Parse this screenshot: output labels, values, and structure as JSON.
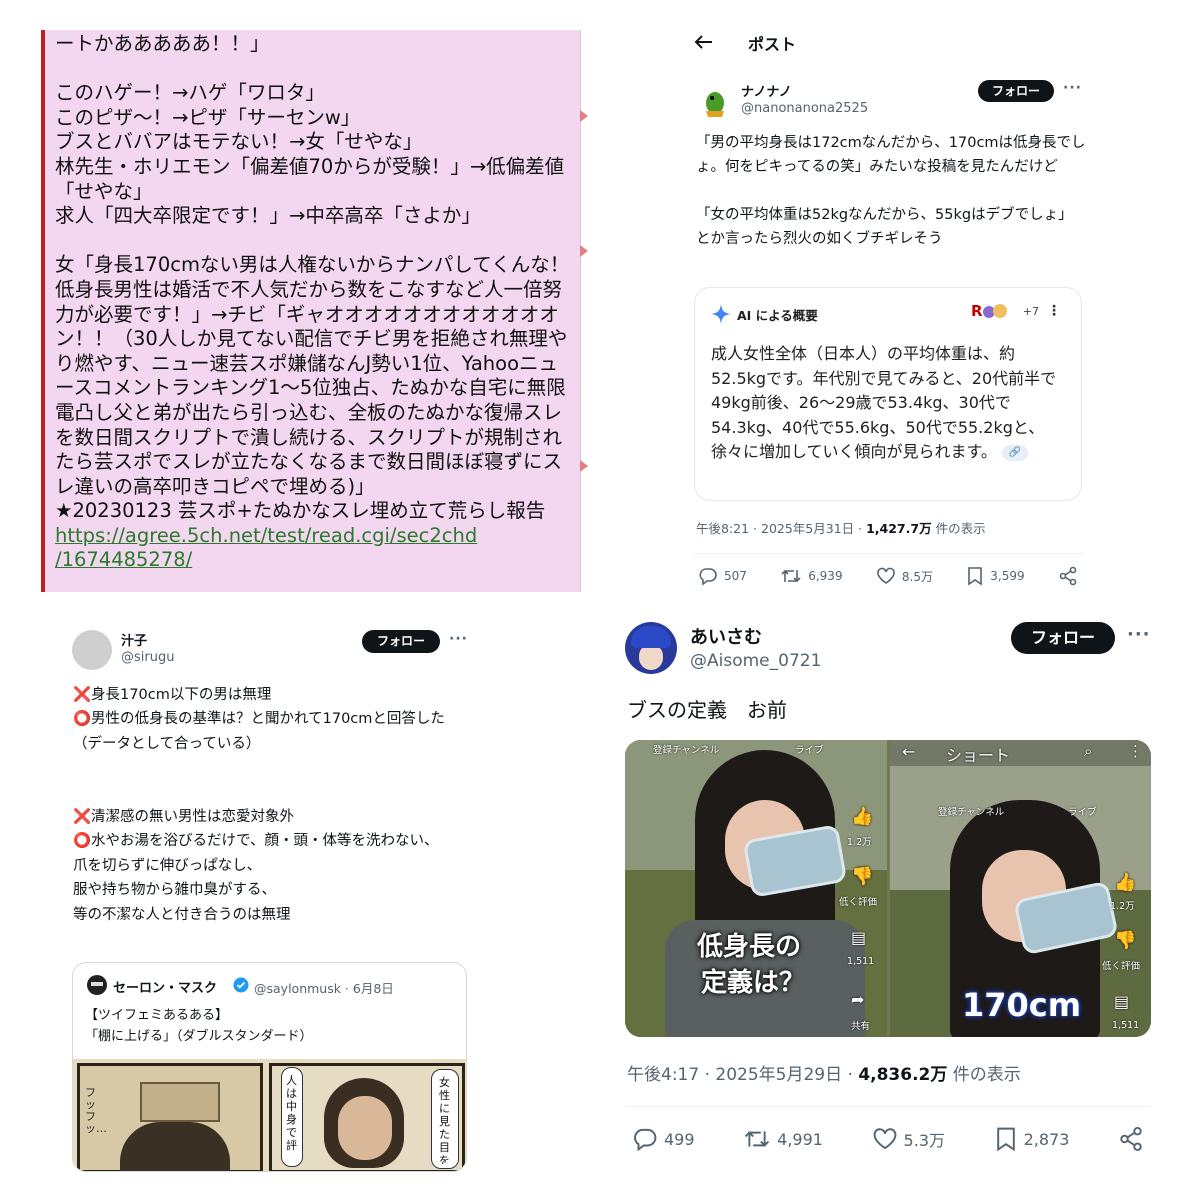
{
  "panel_a": {
    "top_line": "ートかあああああ！！」",
    "lines": [
      "",
      "このハゲー！→ハゲ「ワロタ」",
      "このピザ〜！→ピザ「サーセンw」",
      "ブスとババアはモテない！→女「せやな」",
      "林先生・ホリエモン「偏差値70からが受験！」→低偏差値「せやな」",
      "求人「四大卒限定です！」→中卒高卒「さよか」",
      "",
      "女「身長170cmない男は人権ないからナンパしてくんな！低身長男性は婚活で不人気だから数をこなすなど人一倍努力が必要です！」→チビ「ギャオオオオオオオオオオオオン！！（30人しか見てない配信でチビ男を拒絶され無理やり燃やす、ニュー速芸スポ嫌儲なんJ勢い1位、Yahooニュースコメントランキング1〜5位独占、たぬかな自宅に無限電凸し父と弟が出たら引っ込む、全板のたぬかな復帰スレを数日間スクリプトで潰し続ける、スクリプトが規制されたら芸スポでスレが立たなくなるまで数日間ほぼ寝ずにスレ違いの高卒叩きコピペで埋める)」",
      "★20230123 芸スポ+たぬかなスレ埋め立て荒らし報告"
    ],
    "link_line1": "https://agree.5ch.net/test/read.cgi/sec2chd",
    "link_line2": "/1674485278/",
    "accent": "#c02020",
    "background": "#f3d7f0"
  },
  "panel_b": {
    "header_title": "ポスト",
    "back_icon": "arrow-left-icon",
    "user_name": "ナノナノ",
    "handle": "@nanonanona2525",
    "follow_label": "フォロー",
    "more_label": "···",
    "body": "「男の平均身長は172cmなんだから、170cmは低身長でしょ。何をピキってるの笑」みたいな投稿を見たんだけど\n\n「女の平均体重は52kgなんだから、55kgはデブでしょ」とか言ったら烈火の如くブチギレそう",
    "ai_title": "AI による概要",
    "ai_more": "+7",
    "ai_menu": "⋮",
    "ai_body": "成人女性全体（日本人）の平均体重は、約52.5kgです。年代別で見てみると、20代前半で49kg前後、26〜29歳で53.4kg、30代で54.3kg、40代で55.6kg、50代で55.2kgと、徐々に増加していく傾向が見られます。",
    "time": "午後8:21 · 2025年5月31日 · ",
    "views_count": "1,427.7万",
    "views_label": " 件の表示",
    "replies": "507",
    "reposts": "6,939",
    "likes": "8.5万",
    "bookmarks": "3,599"
  },
  "panel_c": {
    "user_name": "汁子",
    "handle": "@sirugu",
    "follow_label": "フォロー",
    "more_label": "···",
    "body": "❌身長170cm以下の男は無理\n⭕男性の低身長の基準は？と聞かれて170cmと回答した\n（データとして合っている）\n\n\n❌清潔感の無い男性は恋愛対象外\n⭕水やお湯を浴びるだけで、顔・頭・体等を洗わない、\n爪を切らずに伸びっぱなし、\n服や持ち物から雑巾臭がする、\n等の不潔な人と付き合うのは無理",
    "quote_name": "セーロン・マスク",
    "quote_handle": "@saylonmusk · 6月8日",
    "quote_text": "【ツイフェミあるある】\n「棚に上げる」（ダブルスタンダード）",
    "manga_text_1": "人は中身で評",
    "manga_text_2": "女性に見た目をルッキズ",
    "manga_text_3": "フッフッ…"
  },
  "panel_d": {
    "user_name": "あいさむ",
    "handle": "@Aisome_0721",
    "follow_label": "フォロー",
    "more_label": "···",
    "body": "ブスの定義　お前",
    "left_video": {
      "top_labels": [
        "登録チャンネル",
        "ライブ"
      ],
      "caption_1": "低身長の",
      "caption_2": "定義は？",
      "side_counts": [
        "1.2万",
        "低く評価",
        "1,511",
        "共有"
      ]
    },
    "right_video": {
      "header": "ショート",
      "top_labels": [
        "登録チャンネル",
        "ライブ"
      ],
      "caption": "170cm",
      "side_counts": [
        "1.2万",
        "低く評価",
        "1,511"
      ]
    },
    "time": "午後4:17 · 2025年5月29日 · ",
    "views_count": "4,836.2万",
    "views_label": " 件の表示",
    "replies": "499",
    "reposts": "4,991",
    "likes": "5.3万",
    "bookmarks": "2,873"
  }
}
